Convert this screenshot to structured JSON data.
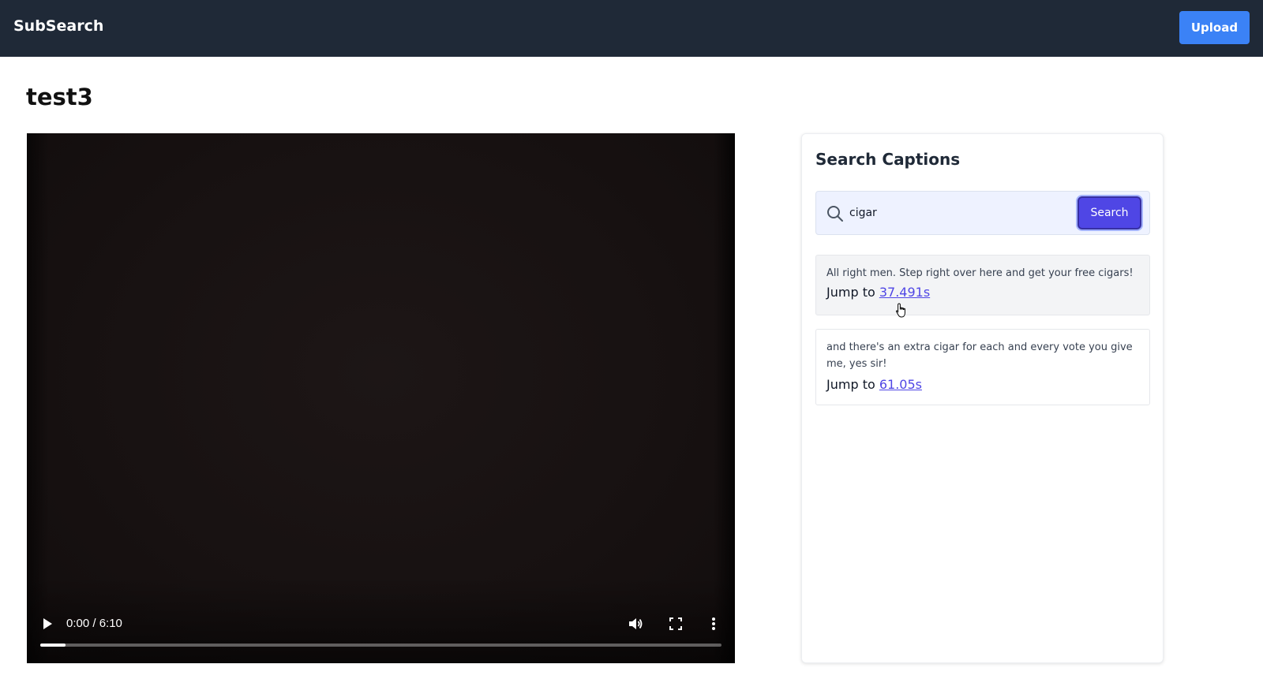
{
  "header": {
    "brand": "SubSearch",
    "upload_label": "Upload"
  },
  "page": {
    "title": "test3"
  },
  "video": {
    "current_time": "0:00",
    "duration": "6:10",
    "time_display": "0:00 / 6:10",
    "progress_fraction": 0.037
  },
  "search_panel": {
    "title": "Search Captions",
    "query": "cigar",
    "search_button_label": "Search",
    "results": [
      {
        "text": "All right men. Step right over here and get your free cigars!",
        "jump_prefix": "Jump to",
        "jump_time": "37.491s"
      },
      {
        "text": "and there's an extra cigar for each and every vote you give me, yes sir!",
        "jump_prefix": "Jump to",
        "jump_time": "61.05s"
      }
    ]
  },
  "colors": {
    "navbar": "#1f2937",
    "upload_button": "#3b82f6",
    "search_button": "#4f46e5",
    "link": "#4f46e5"
  }
}
